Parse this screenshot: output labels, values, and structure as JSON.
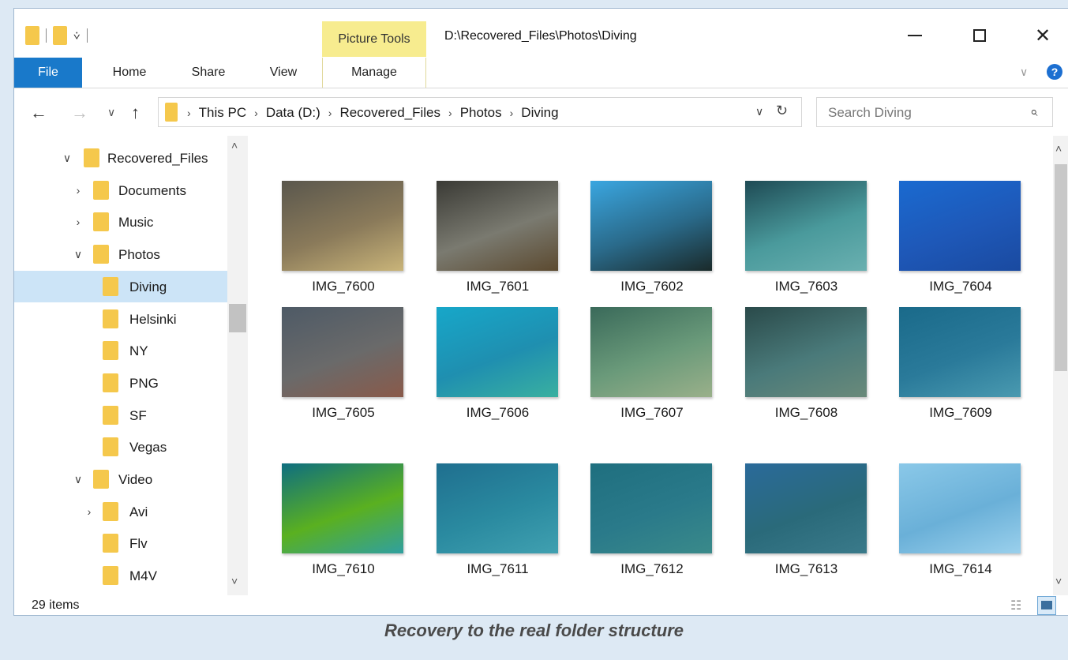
{
  "window": {
    "context_tab": "Picture Tools",
    "title_path": "D:\\Recovered_Files\\Photos\\Diving"
  },
  "ribbon": {
    "tabs": [
      "File",
      "Home",
      "Share",
      "View",
      "Manage"
    ]
  },
  "address": {
    "crumbs": [
      "This PC",
      "Data (D:)",
      "Recovered_Files",
      "Photos",
      "Diving"
    ],
    "search_placeholder": "Search Diving"
  },
  "tree": [
    {
      "label": "Recovered_Files",
      "depth": 0,
      "expander": "expanded"
    },
    {
      "label": "Documents",
      "depth": 1,
      "expander": "collapsed"
    },
    {
      "label": "Music",
      "depth": 1,
      "expander": "collapsed"
    },
    {
      "label": "Photos",
      "depth": 1,
      "expander": "expanded"
    },
    {
      "label": "Diving",
      "depth": 2,
      "expander": "none",
      "selected": true
    },
    {
      "label": "Helsinki",
      "depth": 2,
      "expander": "none"
    },
    {
      "label": "NY",
      "depth": 2,
      "expander": "none"
    },
    {
      "label": "PNG",
      "depth": 2,
      "expander": "none"
    },
    {
      "label": "SF",
      "depth": 2,
      "expander": "none"
    },
    {
      "label": "Vegas",
      "depth": 2,
      "expander": "none"
    },
    {
      "label": "Video",
      "depth": 1,
      "expander": "expanded"
    },
    {
      "label": "Avi",
      "depth": 2,
      "expander": "collapsed"
    },
    {
      "label": "Flv",
      "depth": 2,
      "expander": "none"
    },
    {
      "label": "M4V",
      "depth": 2,
      "expander": "none"
    }
  ],
  "files": [
    {
      "name": "IMG_7600",
      "colors": [
        "#5a574d",
        "#8a7a5a",
        "#c9b479"
      ]
    },
    {
      "name": "IMG_7601",
      "colors": [
        "#3a3a35",
        "#7a7a70",
        "#5c4a30"
      ]
    },
    {
      "name": "IMG_7602",
      "colors": [
        "#3aa6e0",
        "#2a6a8a",
        "#1a2a2a"
      ]
    },
    {
      "name": "IMG_7603",
      "colors": [
        "#1e4a54",
        "#4a9a9c",
        "#6ab0b0"
      ]
    },
    {
      "name": "IMG_7604",
      "colors": [
        "#1a6ad0",
        "#1e58b8",
        "#1a4aa0"
      ]
    },
    {
      "name": "IMG_7605",
      "colors": [
        "#4e5a66",
        "#6a6a6a",
        "#8a5a4a"
      ]
    },
    {
      "name": "IMG_7606",
      "colors": [
        "#17a7c9",
        "#1f8fb0",
        "#3ab0a0"
      ]
    },
    {
      "name": "IMG_7607",
      "colors": [
        "#3a6a5a",
        "#6a9a7a",
        "#9ab08a"
      ]
    },
    {
      "name": "IMG_7608",
      "colors": [
        "#2a4a4a",
        "#4a7a7a",
        "#6a8a7a"
      ]
    },
    {
      "name": "IMG_7609",
      "colors": [
        "#1a6a8a",
        "#2a7a9a",
        "#4a9ab0"
      ]
    },
    {
      "name": "IMG_7610",
      "colors": [
        "#0e6e80",
        "#5ab020",
        "#30a0a0"
      ]
    },
    {
      "name": "IMG_7611",
      "colors": [
        "#1f6f8f",
        "#2a8aa0",
        "#40a0b0"
      ]
    },
    {
      "name": "IMG_7612",
      "colors": [
        "#1f6f7f",
        "#2a7a8a",
        "#3a8a8a"
      ]
    },
    {
      "name": "IMG_7613",
      "colors": [
        "#2a6a9a",
        "#2a6a7a",
        "#3a7a8a"
      ]
    },
    {
      "name": "IMG_7614",
      "colors": [
        "#8ac8e8",
        "#6ab0d8",
        "#9ad0ec"
      ]
    }
  ],
  "status": {
    "count": "29 items"
  },
  "caption": "Recovery to the real folder structure"
}
